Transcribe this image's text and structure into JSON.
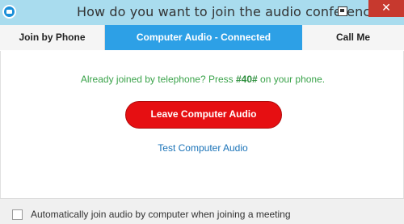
{
  "window": {
    "title": "How do you want to join the audio conference?",
    "close_label": "✕"
  },
  "tabs": [
    {
      "label": "Join by Phone",
      "active": false
    },
    {
      "label": "Computer Audio - Connected",
      "active": true
    },
    {
      "label": "Call Me",
      "active": false
    }
  ],
  "main": {
    "joined_prefix": "Already joined by telephone? Press ",
    "joined_code": "#40#",
    "joined_suffix": " on your phone.",
    "leave_label": "Leave Computer Audio",
    "test_label": "Test Computer Audio"
  },
  "footer": {
    "auto_join_label": "Automatically join audio by computer when joining a meeting",
    "auto_join_checked": false
  },
  "colors": {
    "titlebar_bg": "#a9dcee",
    "active_tab_bg": "#2da0e6",
    "leave_button_bg": "#e60f12",
    "message_green": "#3aa34a",
    "link_blue": "#1a73b8",
    "close_red": "#c7392e"
  }
}
